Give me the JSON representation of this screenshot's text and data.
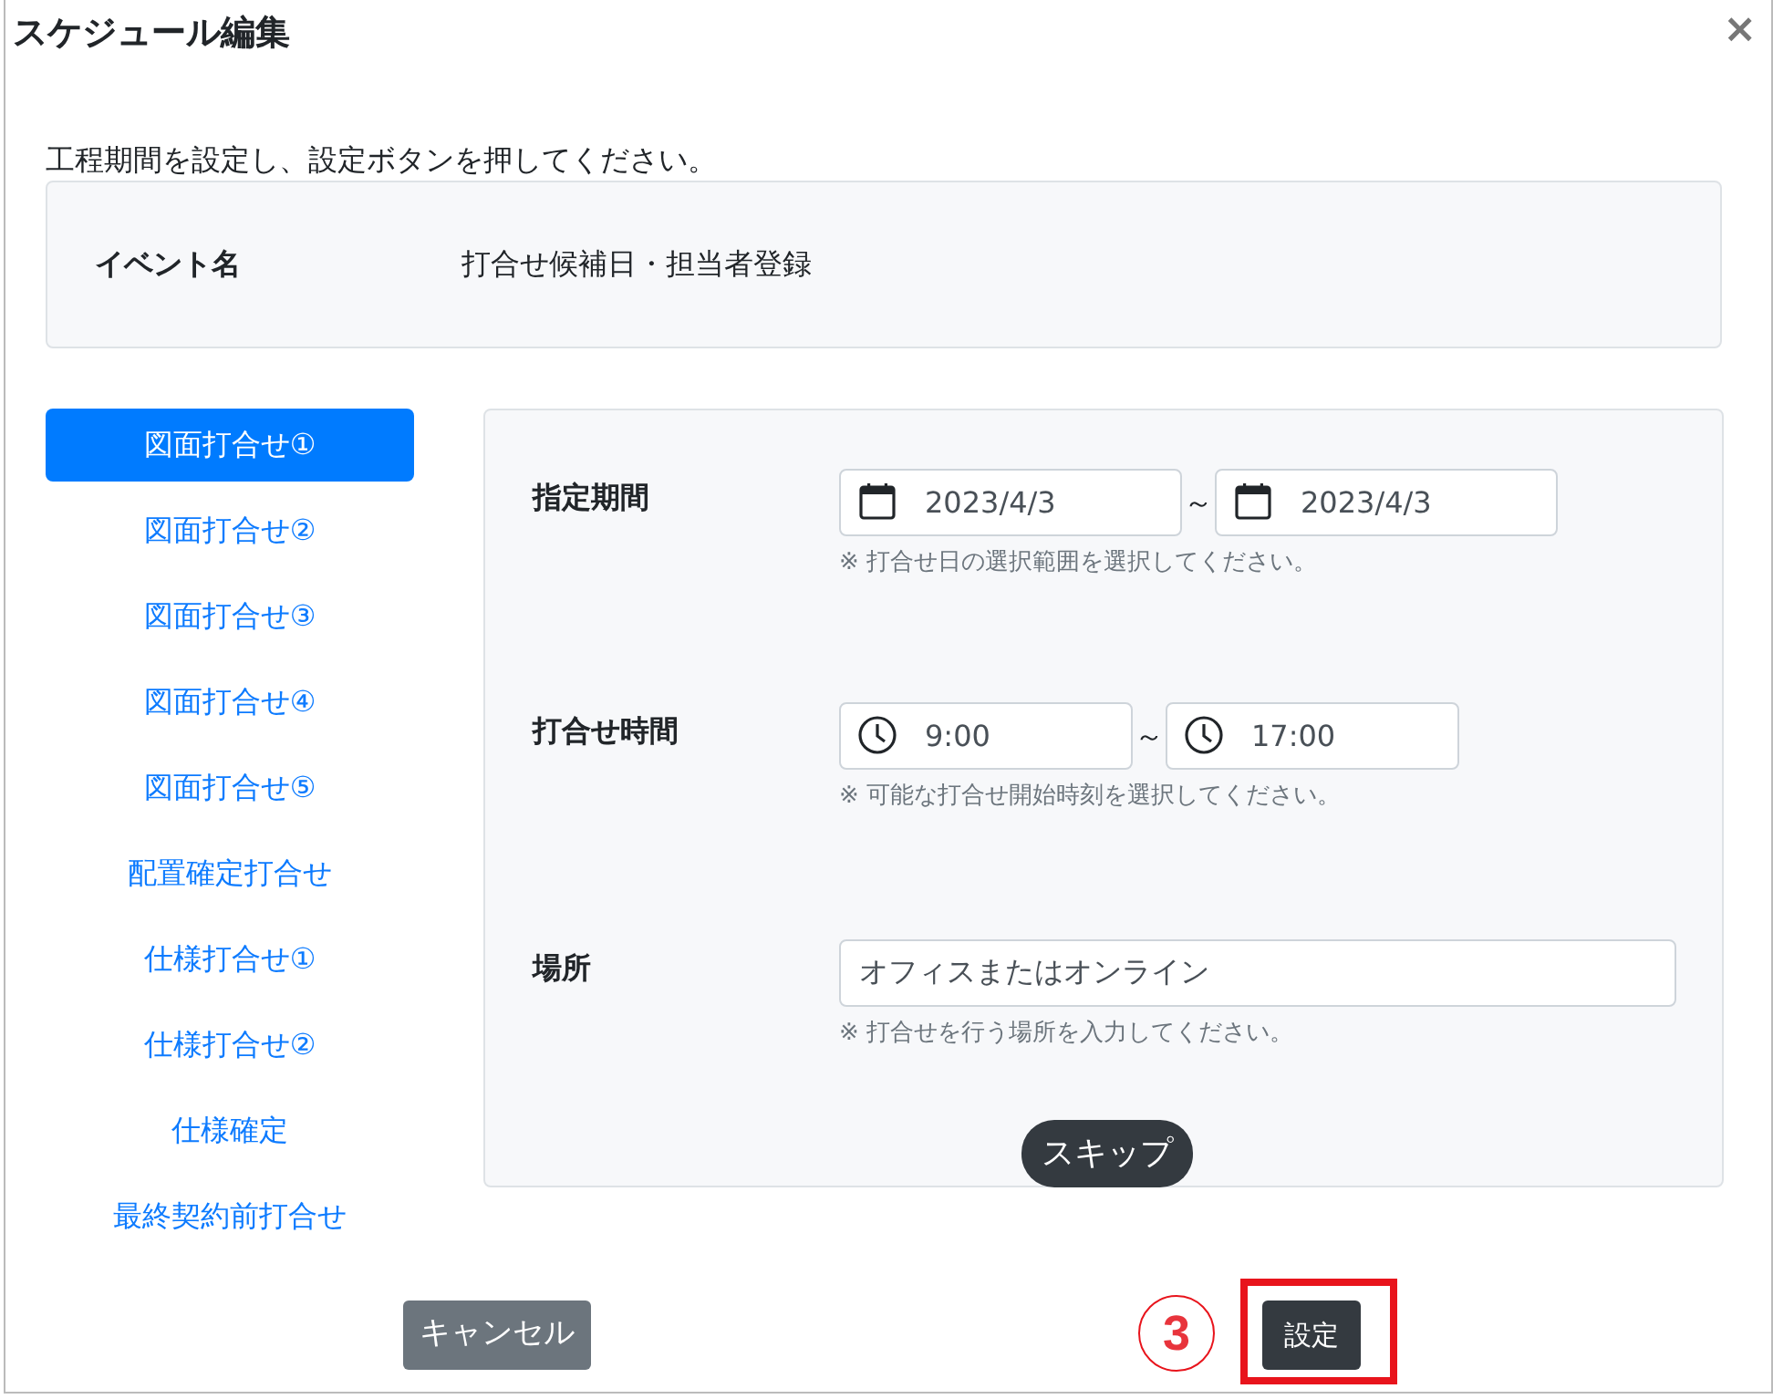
{
  "dialog": {
    "title": "スケジュール編集",
    "close": "×"
  },
  "instruction": "工程期間を設定し、設定ボタンを押してください。",
  "event": {
    "label": "イベント名",
    "value": "打合せ候補日・担当者登録"
  },
  "steps": [
    {
      "label": "図面打合せ①",
      "selected": true
    },
    {
      "label": "図面打合せ②",
      "selected": false
    },
    {
      "label": "図面打合せ③",
      "selected": false
    },
    {
      "label": "図面打合せ④",
      "selected": false
    },
    {
      "label": "図面打合せ⑤",
      "selected": false
    },
    {
      "label": "配置確定打合せ",
      "selected": false
    },
    {
      "label": "仕様打合せ①",
      "selected": false
    },
    {
      "label": "仕様打合せ②",
      "selected": false
    },
    {
      "label": "仕様確定",
      "selected": false
    },
    {
      "label": "最終契約前打合せ",
      "selected": false
    }
  ],
  "form": {
    "rows": [
      {
        "kind": "date_range",
        "label": "指定期間",
        "start": "2023/4/3",
        "separator": "～",
        "end": "2023/4/3",
        "hint": "※ 打合せ日の選択範囲を選択してください。"
      },
      {
        "kind": "time_range",
        "label": "打合せ時間",
        "start": "9:00",
        "separator": "～",
        "end": "17:00",
        "hint": "※ 可能な打合せ開始時刻を選択してください。"
      },
      {
        "kind": "text",
        "label": "場所",
        "value": "オフィスまたはオンライン",
        "hint": "※ 打合せを行う場所を入力してください。"
      }
    ],
    "skip_button": "スキップ"
  },
  "footer": {
    "cancel": "キャンセル",
    "submit": "設定",
    "annotation": "3"
  }
}
